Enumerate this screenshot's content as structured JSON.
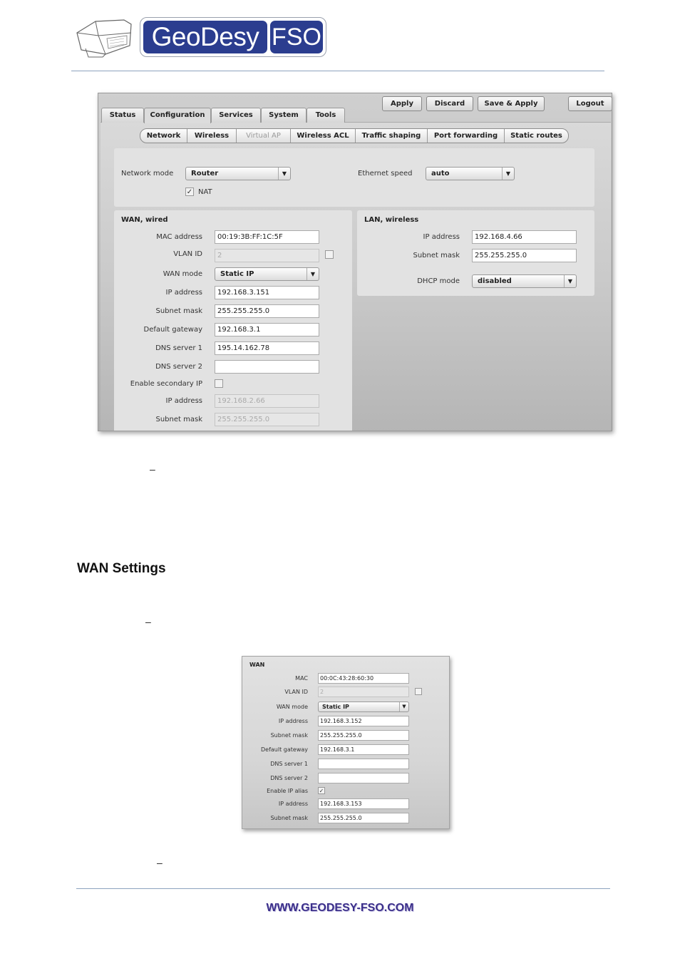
{
  "header": {
    "logo_text": "GeoDesy",
    "logo_badge": "FSO"
  },
  "screenshot1": {
    "main_tabs": [
      "Status",
      "Configuration",
      "Services",
      "System",
      "Tools"
    ],
    "active_main_tab": "Configuration",
    "top_buttons": [
      "Apply",
      "Discard",
      "Save & Apply",
      "Logout"
    ],
    "sub_tabs": [
      "Network",
      "Wireless",
      "Virtual AP",
      "Wireless ACL",
      "Traffic shaping",
      "Port forwarding",
      "Static routes"
    ],
    "disabled_sub_tab": "Virtual AP",
    "network_mode_label": "Network mode",
    "network_mode_value": "Router",
    "ethernet_speed_label": "Ethernet speed",
    "ethernet_speed_value": "auto",
    "nat_label": "NAT",
    "nat_checked": true,
    "wan": {
      "title": "WAN, wired",
      "mac_label": "MAC address",
      "mac_value": "00:19:3B:FF:1C:5F",
      "vlan_label": "VLAN ID",
      "vlan_value": "2",
      "mode_label": "WAN mode",
      "mode_value": "Static IP",
      "ip_label": "IP address",
      "ip_value": "192.168.3.151",
      "mask_label": "Subnet mask",
      "mask_value": "255.255.255.0",
      "gateway_label": "Default gateway",
      "gateway_value": "192.168.3.1",
      "dns1_label": "DNS server 1",
      "dns1_value": "195.14.162.78",
      "dns2_label": "DNS server 2",
      "dns2_value": "",
      "secondary_label": "Enable secondary IP",
      "sec_ip_label": "IP address",
      "sec_ip_value": "192.168.2.66",
      "sec_mask_label": "Subnet mask",
      "sec_mask_value": "255.255.255.0"
    },
    "lan": {
      "title": "LAN, wireless",
      "ip_label": "IP address",
      "ip_value": "192.168.4.66",
      "mask_label": "Subnet mask",
      "mask_value": "255.255.255.0",
      "dhcp_label": "DHCP mode",
      "dhcp_value": "disabled"
    }
  },
  "dash_mark": "–",
  "section_heading": "WAN Settings",
  "screenshot2": {
    "title": "WAN",
    "mac_label": "MAC",
    "mac_value": "00:0C:43:28:60:30",
    "vlan_label": "VLAN ID",
    "vlan_value": "2",
    "mode_label": "WAN mode",
    "mode_value": "Static IP",
    "ip_label": "IP address",
    "ip_value": "192.168.3.152",
    "mask_label": "Subnet mask",
    "mask_value": "255.255.255.0",
    "gateway_label": "Default gateway",
    "gateway_value": "192.168.3.1",
    "dns1_label": "DNS server 1",
    "dns1_value": "",
    "dns2_label": "DNS server 2",
    "dns2_value": "",
    "alias_label": "Enable IP alias",
    "alias_checked": true,
    "alias_ip_label": "IP address",
    "alias_ip_value": "192.168.3.153",
    "alias_mask_label": "Subnet mask",
    "alias_mask_value": "255.255.255.0"
  },
  "footer": {
    "url": "WWW.GEODESY-FSO.COM"
  },
  "colors": {
    "brand_blue": "#2b3d8f",
    "rule_line": "#8da2bf",
    "footer_text": "#3b2f8a"
  }
}
